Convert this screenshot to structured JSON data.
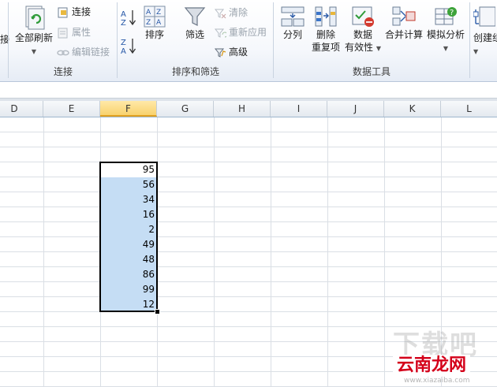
{
  "ribbon": {
    "group_connections": {
      "label": "连接",
      "refresh_all_label": "全部刷新",
      "connections_label": "连接",
      "properties_label": "属性",
      "edit_links_label": "编辑链接"
    },
    "group_sort_filter": {
      "label": "排序和筛选",
      "sort_label": "排序",
      "filter_label": "筛选",
      "clear_label": "清除",
      "reapply_label": "重新应用",
      "advanced_label": "高级"
    },
    "group_data_tools": {
      "label": "数据工具",
      "text_to_columns_label": "分列",
      "remove_duplicates_line1": "删除",
      "remove_duplicates_line2": "重复项",
      "data_validation_line1": "数据",
      "data_validation_line2": "有效性",
      "consolidate_label": "合并计算",
      "what_if_label": "模拟分析"
    },
    "group_outline": {
      "group_label_partial": "创建组"
    },
    "partial_left_label": "接"
  },
  "columns": [
    "D",
    "E",
    "F",
    "G",
    "H",
    "I",
    "J",
    "K",
    "L"
  ],
  "selected_column": "F",
  "cells_F": [
    "95",
    "56",
    "34",
    "16",
    "2",
    "49",
    "48",
    "86",
    "99",
    "12"
  ],
  "watermark": {
    "top_text": "下载吧",
    "brand_text": "云南龙网",
    "url_text": "www.xiazaiba.com"
  }
}
